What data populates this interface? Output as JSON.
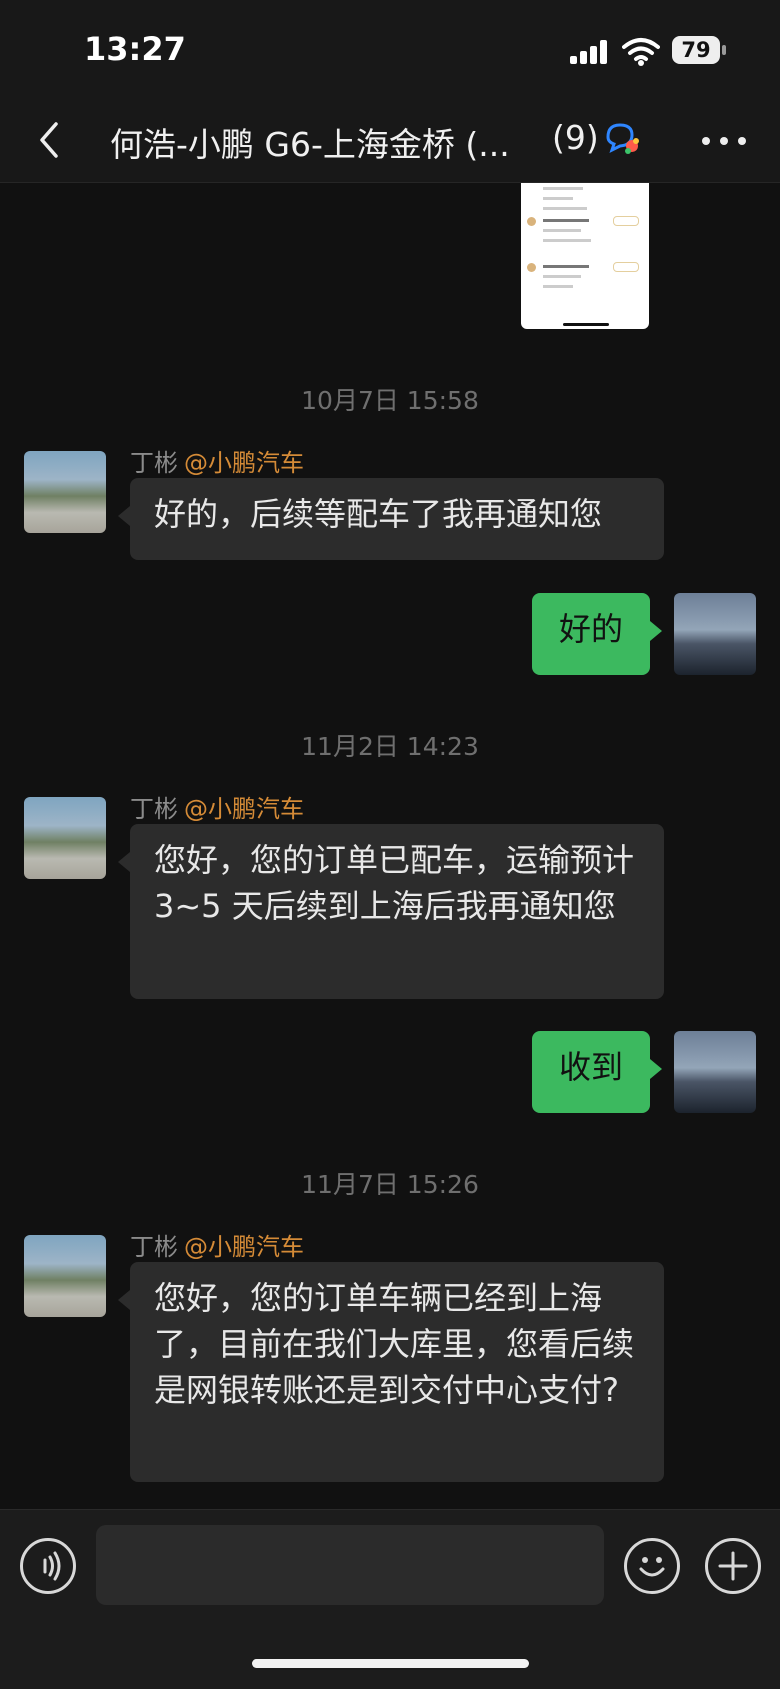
{
  "status_bar": {
    "time": "13:27",
    "battery": "79"
  },
  "nav": {
    "title": "何浩-小鹏 G6-上海金桥 (...",
    "member_count": "(9)"
  },
  "messages": {
    "ts1": "10月7日 15:58",
    "m1_sender": "丁彬",
    "m1_tag": "@小鹏汽车",
    "m1_text": "好的，后续等配车了我再通知您",
    "m2_text": "好的",
    "ts2": "11月2日 14:23",
    "m3_sender": "丁彬",
    "m3_tag": "@小鹏汽车",
    "m3_text": "您好，您的订单已配车，运输预计 3~5 天后续到上海后我再通知您",
    "m4_text": "收到",
    "ts3": "11月7日 15:26",
    "m5_sender": "丁彬",
    "m5_tag": "@小鹏汽车",
    "m5_text": "您好，您的订单车辆已经到上海了，目前在我们大库里，您看后续是网银转账还是到交付中心支付?"
  },
  "input": {
    "placeholder": ""
  },
  "colors": {
    "background": "#111111",
    "outgoing_bubble": "#3cb95f",
    "incoming_bubble": "#2c2c2c",
    "sender_tag": "#d58b37"
  },
  "icons": [
    "back-chevron-icon",
    "group-chat-icon",
    "more-icon",
    "voice-icon",
    "emoji-icon",
    "add-icon"
  ]
}
